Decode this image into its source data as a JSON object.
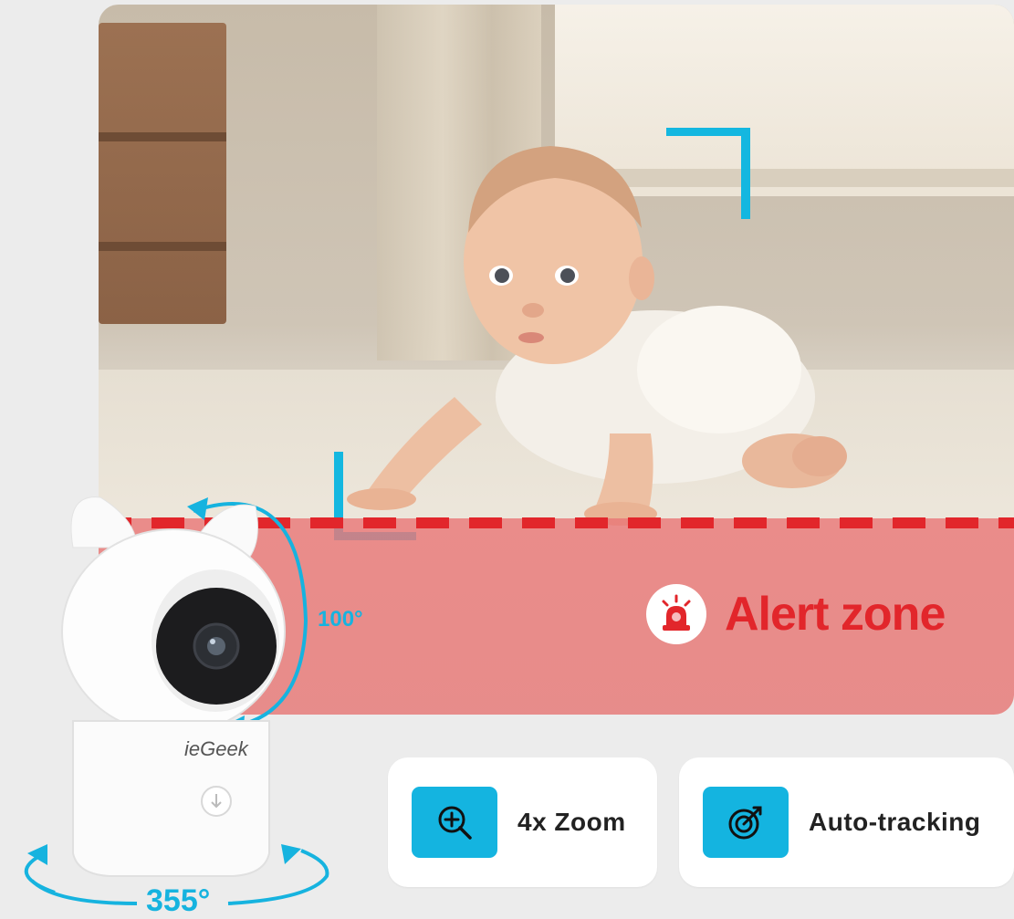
{
  "scene": {
    "alert_zone_label": "Alert zone",
    "alert_icon": "siren-icon"
  },
  "camera": {
    "brand": "ieGeek",
    "tilt_angle": "100°",
    "pan_angle": "355°"
  },
  "features": [
    {
      "label": "4x Zoom",
      "icon": "zoom-in-icon"
    },
    {
      "label": "Auto-tracking",
      "icon": "target-tracking-icon"
    }
  ],
  "colors": {
    "accent": "#14b4e0",
    "alert": "#e2262b"
  }
}
